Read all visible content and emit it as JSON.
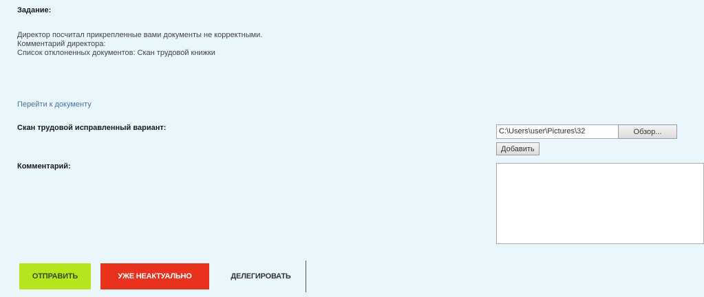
{
  "task": {
    "heading": "Задание:",
    "lines": [
      "Директор посчитал прикрепленные вами документы не корректными.",
      "Комментарий директора:",
      "Список отклоненных документов: Скан трудовой книжки"
    ],
    "doc_link": "Перейти к документу"
  },
  "form": {
    "scan_label": "Скан трудовой исправленный вариант:",
    "file_path": "C:\\Users\\user\\Pictures\\32",
    "browse_label": "Обзор...",
    "add_label": "Добавить",
    "comment_label": "Комментарий:",
    "comment_value": ""
  },
  "actions": {
    "send_label": "ОТПРАВИТЬ",
    "obsolete_label": "УЖЕ НЕАКТУАЛЬНО",
    "delegate_label": "ДЕЛЕГИРОВАТЬ"
  },
  "colors": {
    "background": "#e9f6fc",
    "send": "#b5e61d",
    "obsolete": "#e8321e",
    "link": "#4a6fa5"
  }
}
